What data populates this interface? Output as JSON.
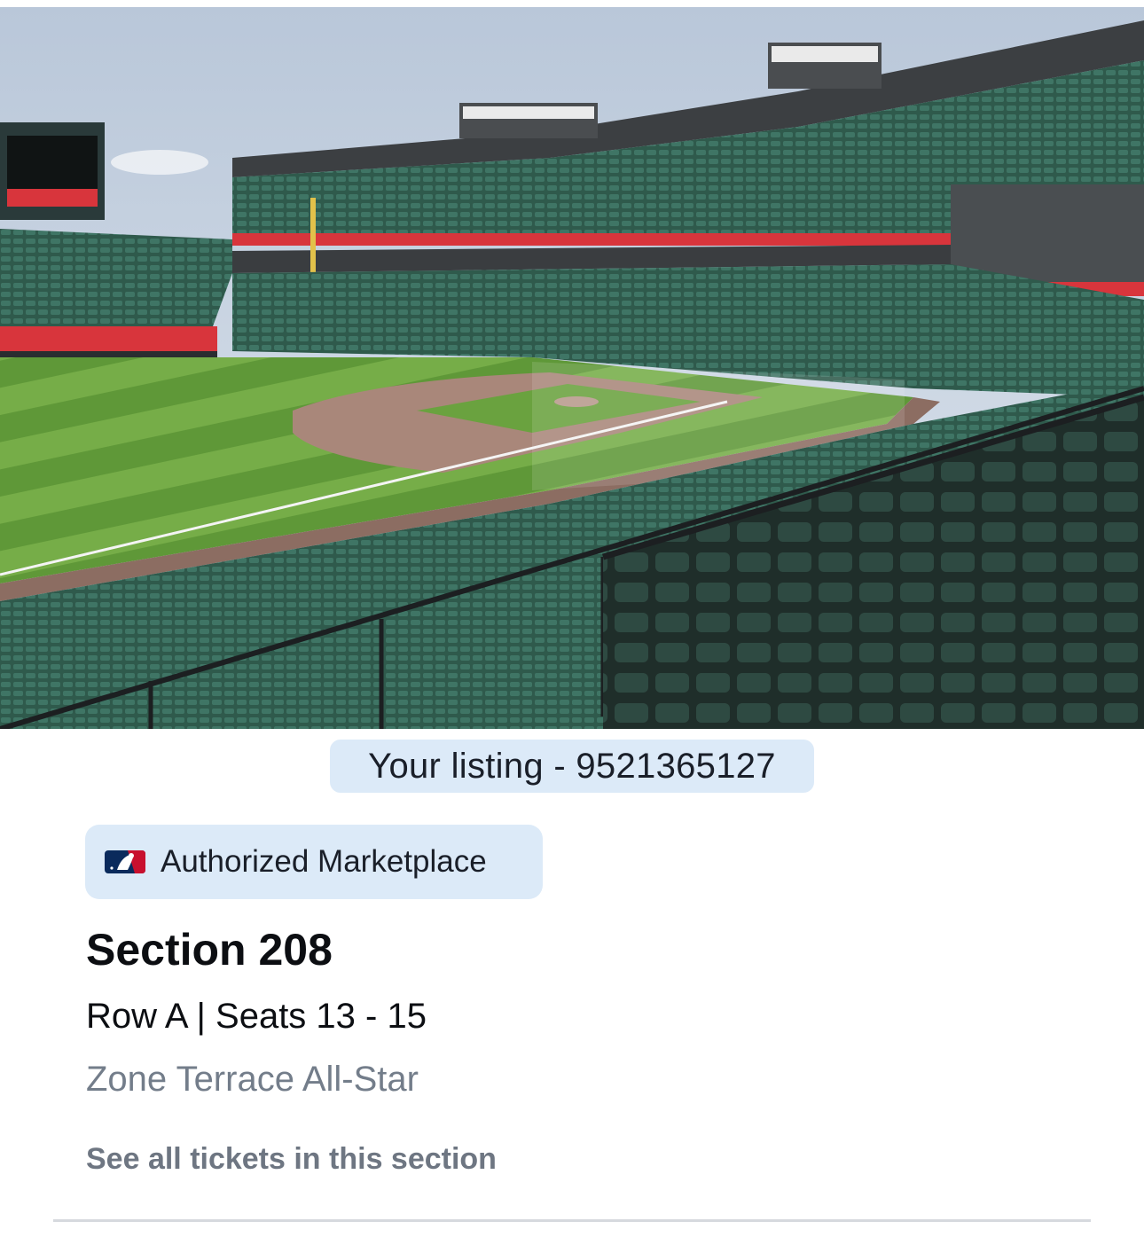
{
  "seat_view": {
    "image_description_icon": "stadium-seat-view-image"
  },
  "listing": {
    "label": "Your listing - 9521365127"
  },
  "badge": {
    "icon": "mlb-logo-icon",
    "label": "Authorized Marketplace"
  },
  "ticket": {
    "section": "Section 208",
    "row_seats": "Row A | Seats 13 - 15",
    "zone": "Zone Terrace All-Star"
  },
  "actions": {
    "see_all": "See all tickets in this section"
  },
  "colors": {
    "pill_bg": "#dceaf8",
    "text_primary": "#0c0e12",
    "text_secondary": "#737d8a",
    "link": "#6e7682"
  }
}
